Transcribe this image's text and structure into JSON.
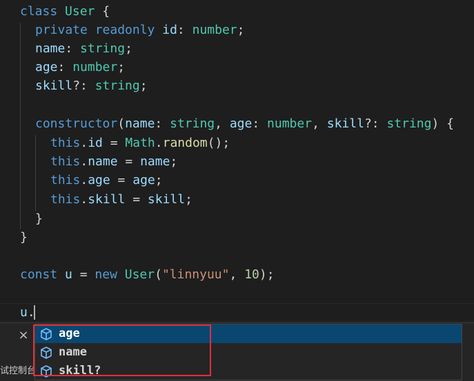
{
  "code": {
    "l1": {
      "k": "class",
      "c": "User",
      "p": " {"
    },
    "l2": {
      "k": "private readonly",
      "n": "id",
      "p": ": ",
      "t": "number",
      "e": ";"
    },
    "l3": {
      "n": "name",
      "p": ": ",
      "t": "string",
      "e": ";"
    },
    "l4": {
      "n": "age",
      "p": ": ",
      "t": "number",
      "e": ";"
    },
    "l5": {
      "n": "skill",
      "p": "?: ",
      "t": "string",
      "e": ";"
    },
    "l7": {
      "k": "constructor",
      "a": "(",
      "n1": "name",
      "p1": ": ",
      "t1": "string",
      "c1": ", ",
      "n2": "age",
      "p2": ": ",
      "t2": "number",
      "c2": ", ",
      "n3": "skill",
      "p3": "?: ",
      "t3": "string",
      "e": ") {"
    },
    "l8": {
      "k": "this",
      "d": ".",
      "n": "id",
      "eq": " = ",
      "obj": "Math",
      "d2": ".",
      "f": "random",
      "e": "();"
    },
    "l9": {
      "k": "this",
      "d": ".",
      "n": "name",
      "eq": " = ",
      "v": "name",
      "e": ";"
    },
    "l10": {
      "k": "this",
      "d": ".",
      "n": "age",
      "eq": " = ",
      "v": "age",
      "e": ";"
    },
    "l11": {
      "k": "this",
      "d": ".",
      "n": "skill",
      "eq": " = ",
      "v": "skill",
      "e": ";"
    },
    "l12": {
      "p": "}"
    },
    "l13": {
      "p": "}"
    },
    "l15": {
      "k": "const",
      "v": "u",
      "eq": " = ",
      "k2": "new",
      "c": "User",
      "a": "(",
      "s": "\"linnyuu\"",
      "cm": ", ",
      "num": "10",
      "e": ");"
    },
    "l17": {
      "v": "u",
      "d": "."
    }
  },
  "suggest": {
    "items": [
      {
        "label": "age",
        "selected": true
      },
      {
        "label": "name",
        "selected": false
      },
      {
        "label": "skill?",
        "selected": false
      }
    ],
    "icon": "cube-icon"
  },
  "close_symbol": "×",
  "bottom_label": "试控制台",
  "colors": {
    "keyword": "#569cd6",
    "class": "#4ec9b0",
    "property": "#9cdcfe",
    "function": "#dcdcaa",
    "string": "#ce9178",
    "number": "#b5cea8",
    "selection": "#094771",
    "highlight": "#e0303a"
  }
}
